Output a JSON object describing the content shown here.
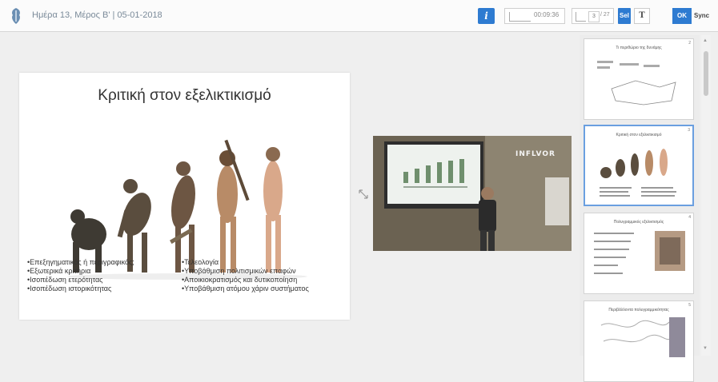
{
  "header": {
    "title": "Ημέρα 13, Μέρος Β' | 05-01-2018",
    "info_label": "i",
    "time": "00:09:36",
    "page_current": "3",
    "page_total": "/ 27",
    "sel_label": "Sel",
    "text_label": "T",
    "ok_label": "OK",
    "sync_label": "Sync"
  },
  "slide": {
    "title": "Κριτική στον εξελικτικισμό",
    "bullets_left": [
      "•Επεξηγηματικός ή περιγραφικός;",
      "•Εξωτερικά κριτήρια",
      "•Ισοπέδωση ετερότητας",
      "•Ισοπέδωση ιστορικότητας"
    ],
    "bullets_right": [
      "•Τελεολογία",
      "•Υποβάθμιση πολιτισμικών επαφών",
      "•Αποικιοκρατισμός και δυτικοποίηση",
      "•Υποβάθμιση ατόμου χάριν συστήματος"
    ]
  },
  "video": {
    "watermark": "INFLVOR"
  },
  "thumbnails": [
    {
      "num": "2",
      "title": "Τι περιθώριο της δυνάμης"
    },
    {
      "num": "3",
      "title": "Κριτική στον εξελικτικισμό"
    },
    {
      "num": "4",
      "title": "Πολυγραμμικός εξελικτισμός"
    },
    {
      "num": "5",
      "title": "Περιβάλλοντα πολυγραμμικότητας"
    }
  ],
  "colors": {
    "accent": "#2e7bd1",
    "selected_border": "#6a9fe0"
  }
}
